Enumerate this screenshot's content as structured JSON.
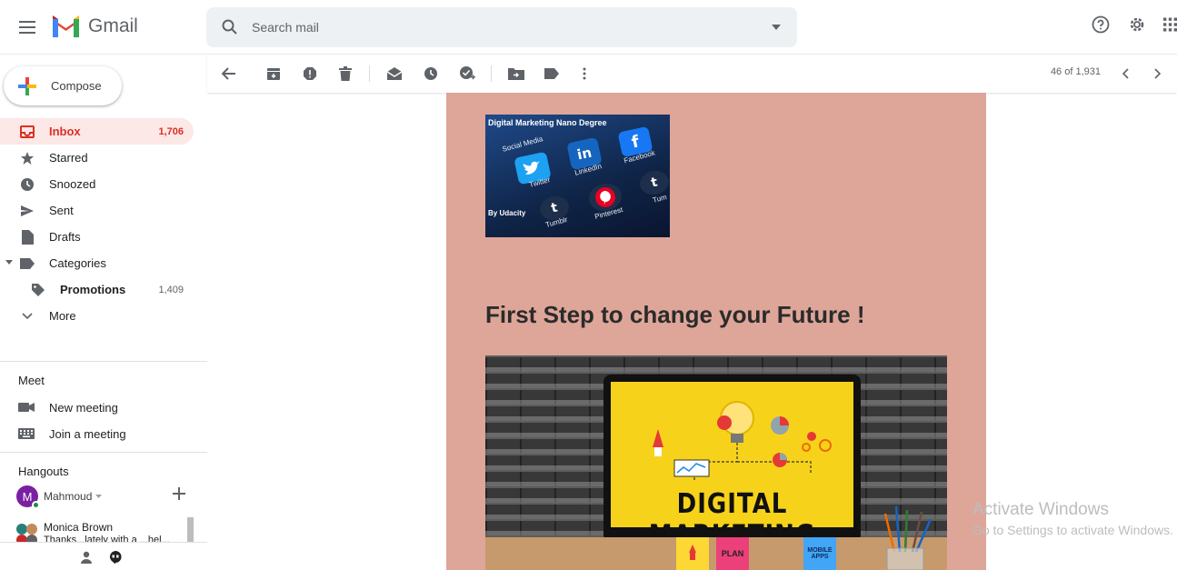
{
  "app": {
    "name": "Gmail"
  },
  "search": {
    "placeholder": "Search mail"
  },
  "compose": {
    "label": "Compose"
  },
  "nav": {
    "items": [
      {
        "label": "Inbox",
        "count": "1,706",
        "icon": "inbox-icon",
        "active": true
      },
      {
        "label": "Starred",
        "count": "",
        "icon": "star-icon"
      },
      {
        "label": "Snoozed",
        "count": "",
        "icon": "clock-icon"
      },
      {
        "label": "Sent",
        "count": "",
        "icon": "send-icon"
      },
      {
        "label": "Drafts",
        "count": "",
        "icon": "draft-icon"
      },
      {
        "label": "Categories",
        "count": "",
        "icon": "label-icon"
      },
      {
        "label": "Promotions",
        "count": "1,409",
        "icon": "tag-icon"
      },
      {
        "label": "More",
        "count": "",
        "icon": "chevron-down-icon"
      }
    ]
  },
  "meet": {
    "title": "Meet",
    "new_meeting": "New meeting",
    "join_meeting": "Join a meeting"
  },
  "hangouts": {
    "title": "Hangouts",
    "user_initial": "M",
    "user_name": "Mahmoud",
    "contact_name": "Monica Brown",
    "contact_snippet": "Thanks...lately with a ...hel..."
  },
  "toolbar": {
    "pager": "46 of 1,931"
  },
  "email": {
    "banner_title": "Digital Marketing Nano Degree",
    "banner_by": "By Udacity",
    "banner_labels": [
      "Social Media",
      "Twitter",
      "LinkedIn",
      "Facebook",
      "Tumblr",
      "Pinterest",
      "Tum"
    ],
    "headline": "First Step to change your Future !",
    "hero_text": "DIGITAL MARKETING",
    "hero_notes": [
      "PLAN",
      "MOBILE APPS"
    ]
  },
  "watermark": {
    "line1": "Activate Windows",
    "line2": "Go to Settings to activate Windows."
  },
  "colors": {
    "accent_red": "#d93025",
    "email_bg": "#dea599",
    "active_bg": "#fce8e6"
  }
}
